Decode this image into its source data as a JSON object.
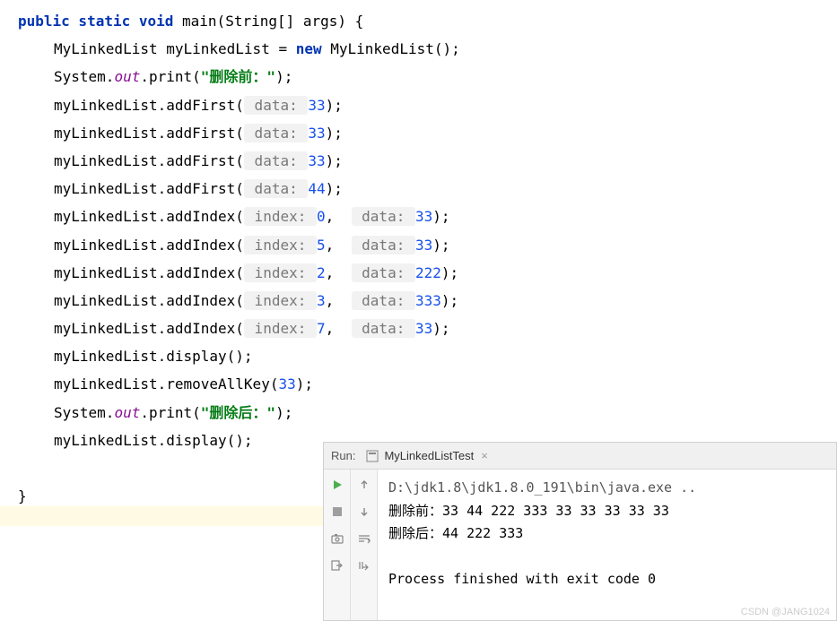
{
  "code": {
    "l1_kw1": "public static void",
    "l1_name": " main(String[] args) {",
    "l2a": "MyLinkedList myLinkedList = ",
    "l2_kw": "new",
    "l2b": " MyLinkedList();",
    "l3a": "System.",
    "l3_field": "out",
    "l3b": ".print(",
    "l3_str": "\"删除前：\"",
    "l3c": ");",
    "l4a": "myLinkedList.addFirst(",
    "hint_data": " data: ",
    "l4_num": "33",
    "l4c": ");",
    "l5_num": "33",
    "l6_num": "33",
    "l7_num": "44",
    "l8a": "myLinkedList.addIndex(",
    "hint_index": " index: ",
    "l8_num1": "0",
    "comma": ",  ",
    "l8_num2": "33",
    "l8c": ");",
    "l9_num1": "5",
    "l9_num2": "33",
    "l10_num1": "2",
    "l10_num2": "222",
    "l11_num1": "3",
    "l11_num2": "333",
    "l12_num1": "7",
    "l12_num2": "33",
    "l13": "myLinkedList.display();",
    "l14a": "myLinkedList.removeAllKey(",
    "l14_num": "33",
    "l14b": ");",
    "l15a": "System.",
    "l15_field": "out",
    "l15b": ".print(",
    "l15_str": "\"删除后：\"",
    "l15c": ");",
    "l16": "myLinkedList.display();",
    "l18": "}"
  },
  "run": {
    "label": "Run:",
    "tab_title": "MyLinkedListTest",
    "close": "×",
    "out_path": "D:\\jdk1.8\\jdk1.8.0_191\\bin\\java.exe ..",
    "out_line1": "删除前：33 44 222 333 33 33 33 33 33",
    "out_line2": "删除后：44 222 333",
    "out_blank": "",
    "out_exit": "Process finished with exit code 0"
  },
  "watermark": "CSDN @JANG1024"
}
